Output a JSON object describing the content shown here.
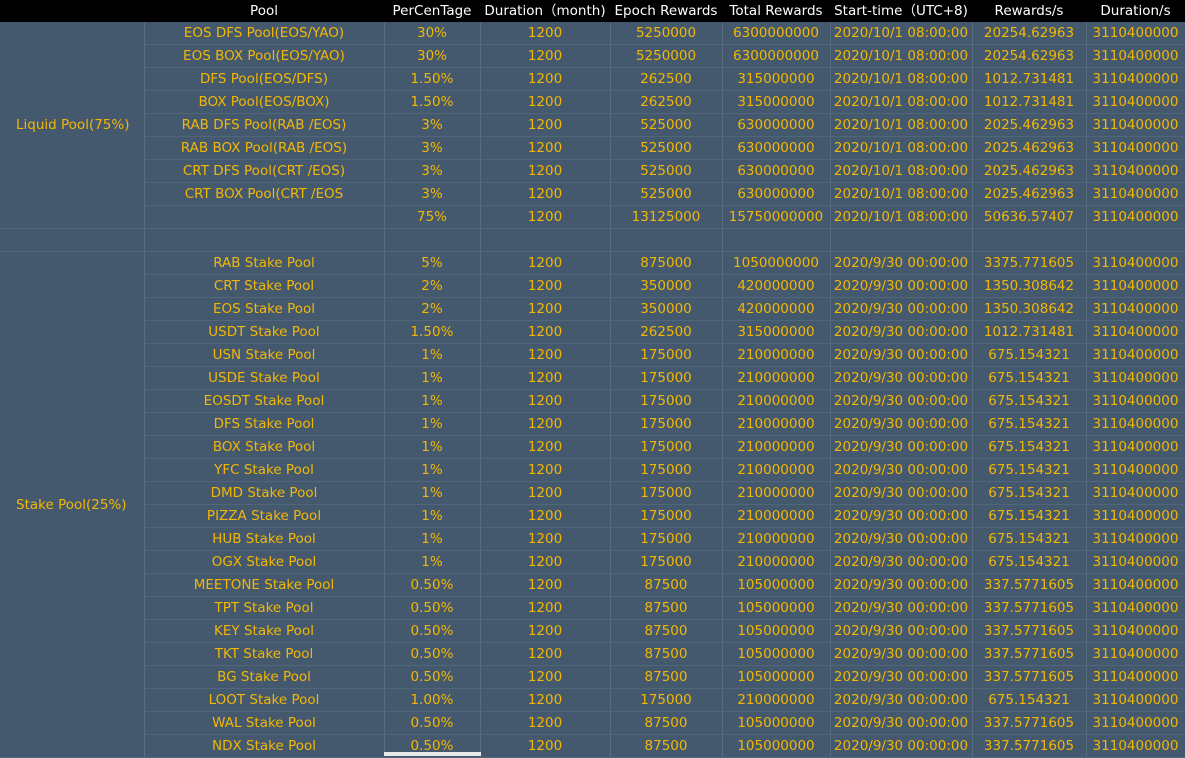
{
  "headers": [
    "",
    "Pool",
    "PerCenTage",
    "Duration（month)",
    "Epoch Rewards",
    "Total Rewards",
    "Start-time（UTC+8)",
    "Rewards/s",
    "Duration/s"
  ],
  "groups": [
    {
      "label": "Liquid Pool(75%)",
      "rows": [
        [
          "EOS DFS Pool(EOS/YAO)",
          "30%",
          "1200",
          "5250000",
          "6300000000",
          "2020/10/1 08:00:00",
          "20254.62963",
          "3110400000"
        ],
        [
          "EOS BOX Pool(EOS/YAO)",
          "30%",
          "1200",
          "5250000",
          "6300000000",
          "2020/10/1 08:00:00",
          "20254.62963",
          "3110400000"
        ],
        [
          "DFS Pool(EOS/DFS)",
          "1.50%",
          "1200",
          "262500",
          "315000000",
          "2020/10/1 08:00:00",
          "1012.731481",
          "3110400000"
        ],
        [
          "BOX Pool(EOS/BOX)",
          "1.50%",
          "1200",
          "262500",
          "315000000",
          "2020/10/1 08:00:00",
          "1012.731481",
          "3110400000"
        ],
        [
          "RAB DFS Pool(RAB /EOS)",
          "3%",
          "1200",
          "525000",
          "630000000",
          "2020/10/1 08:00:00",
          "2025.462963",
          "3110400000"
        ],
        [
          "RAB BOX Pool(RAB /EOS)",
          "3%",
          "1200",
          "525000",
          "630000000",
          "2020/10/1 08:00:00",
          "2025.462963",
          "3110400000"
        ],
        [
          "CRT DFS Pool(CRT /EOS)",
          "3%",
          "1200",
          "525000",
          "630000000",
          "2020/10/1 08:00:00",
          "2025.462963",
          "3110400000"
        ],
        [
          "CRT BOX Pool(CRT /EOS",
          "3%",
          "1200",
          "525000",
          "630000000",
          "2020/10/1 08:00:00",
          "2025.462963",
          "3110400000"
        ],
        [
          "",
          "75%",
          "1200",
          "13125000",
          "15750000000",
          "2020/10/1 08:00:00",
          "50636.57407",
          "3110400000"
        ]
      ]
    },
    {
      "label": "Stake Pool(25%)",
      "rows": [
        [
          "RAB Stake Pool",
          "5%",
          "1200",
          "875000",
          "1050000000",
          "2020/9/30 00:00:00",
          "3375.771605",
          "3110400000"
        ],
        [
          "CRT Stake Pool",
          "2%",
          "1200",
          "350000",
          "420000000",
          "2020/9/30 00:00:00",
          "1350.308642",
          "3110400000"
        ],
        [
          "EOS Stake Pool",
          "2%",
          "1200",
          "350000",
          "420000000",
          "2020/9/30 00:00:00",
          "1350.308642",
          "3110400000"
        ],
        [
          "USDT Stake Pool",
          "1.50%",
          "1200",
          "262500",
          "315000000",
          "2020/9/30 00:00:00",
          "1012.731481",
          "3110400000"
        ],
        [
          "USN Stake Pool",
          "1%",
          "1200",
          "175000",
          "210000000",
          "2020/9/30 00:00:00",
          "675.154321",
          "3110400000"
        ],
        [
          "USDE Stake Pool",
          "1%",
          "1200",
          "175000",
          "210000000",
          "2020/9/30 00:00:00",
          "675.154321",
          "3110400000"
        ],
        [
          "EOSDT Stake Pool",
          "1%",
          "1200",
          "175000",
          "210000000",
          "2020/9/30 00:00:00",
          "675.154321",
          "3110400000"
        ],
        [
          "DFS Stake Pool",
          "1%",
          "1200",
          "175000",
          "210000000",
          "2020/9/30 00:00:00",
          "675.154321",
          "3110400000"
        ],
        [
          "BOX Stake Pool",
          "1%",
          "1200",
          "175000",
          "210000000",
          "2020/9/30 00:00:00",
          "675.154321",
          "3110400000"
        ],
        [
          "YFC Stake Pool",
          "1%",
          "1200",
          "175000",
          "210000000",
          "2020/9/30 00:00:00",
          "675.154321",
          "3110400000"
        ],
        [
          "DMD Stake Pool",
          "1%",
          "1200",
          "175000",
          "210000000",
          "2020/9/30 00:00:00",
          "675.154321",
          "3110400000"
        ],
        [
          "PIZZA Stake Pool",
          "1%",
          "1200",
          "175000",
          "210000000",
          "2020/9/30 00:00:00",
          "675.154321",
          "3110400000"
        ],
        [
          "HUB Stake Pool",
          "1%",
          "1200",
          "175000",
          "210000000",
          "2020/9/30 00:00:00",
          "675.154321",
          "3110400000"
        ],
        [
          "OGX Stake Pool",
          "1%",
          "1200",
          "175000",
          "210000000",
          "2020/9/30 00:00:00",
          "675.154321",
          "3110400000"
        ],
        [
          "MEETONE Stake Pool",
          "0.50%",
          "1200",
          "87500",
          "105000000",
          "2020/9/30 00:00:00",
          "337.5771605",
          "3110400000"
        ],
        [
          "TPT Stake Pool",
          "0.50%",
          "1200",
          "87500",
          "105000000",
          "2020/9/30 00:00:00",
          "337.5771605",
          "3110400000"
        ],
        [
          "KEY Stake Pool",
          "0.50%",
          "1200",
          "87500",
          "105000000",
          "2020/9/30 00:00:00",
          "337.5771605",
          "3110400000"
        ],
        [
          "TKT Stake Pool",
          "0.50%",
          "1200",
          "87500",
          "105000000",
          "2020/9/30 00:00:00",
          "337.5771605",
          "3110400000"
        ],
        [
          "BG Stake Pool",
          "0.50%",
          "1200",
          "87500",
          "105000000",
          "2020/9/30 00:00:00",
          "337.5771605",
          "3110400000"
        ],
        [
          "LOOT Stake Pool",
          "1.00%",
          "1200",
          "175000",
          "210000000",
          "2020/9/30 00:00:00",
          "675.154321",
          "3110400000"
        ],
        [
          "WAL Stake Pool",
          "0.50%",
          "1200",
          "87500",
          "105000000",
          "2020/9/30 00:00:00",
          "337.5771605",
          "3110400000"
        ],
        [
          "NDX Stake Pool",
          "0.50%",
          "1200",
          "87500",
          "105000000",
          "2020/9/30 00:00:00",
          "337.5771605",
          "3110400000"
        ]
      ]
    }
  ],
  "colors": {
    "background": "#44596e",
    "header_background": "#000000",
    "header_text": "#ffffff",
    "cell_text": "#f2b705"
  }
}
